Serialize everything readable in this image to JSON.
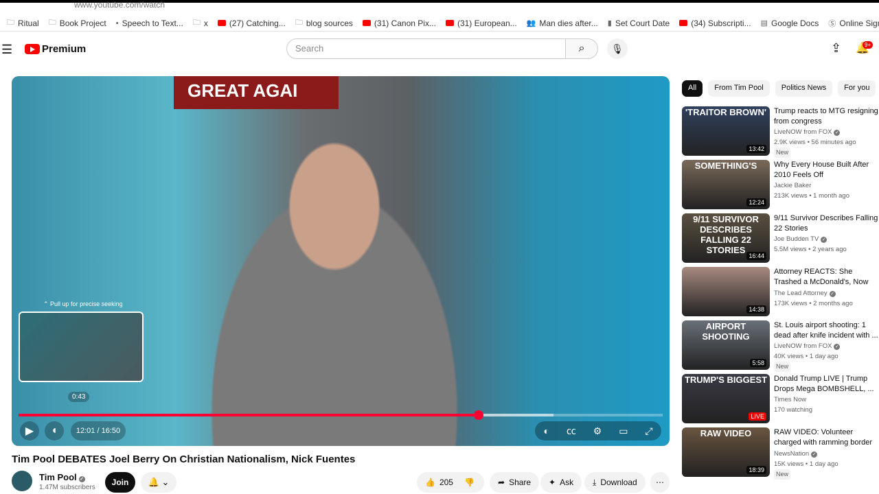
{
  "browser": {
    "url": "www.youtube.com/watch",
    "bookmarks": [
      {
        "icon": "folder-icon",
        "label": "Ritual"
      },
      {
        "icon": "folder-icon",
        "label": "Book Project"
      },
      {
        "icon": "page-icon",
        "label": "Speech to Text..."
      },
      {
        "icon": "folder-icon",
        "label": "x"
      },
      {
        "icon": "youtube-icon",
        "label": "(27) Catching..."
      },
      {
        "icon": "folder-icon",
        "label": "blog sources"
      },
      {
        "icon": "youtube-icon",
        "label": "(31) Canon Pix..."
      },
      {
        "icon": "youtube-icon",
        "label": "(31) European..."
      },
      {
        "icon": "people-icon",
        "label": "Man dies after..."
      },
      {
        "icon": "doc-icon",
        "label": "Set Court Date"
      },
      {
        "icon": "youtube-icon",
        "label": "(34) Subscripti..."
      },
      {
        "icon": "google-docs-icon",
        "label": "Google Docs"
      },
      {
        "icon": "signature-icon",
        "label": "Online Signatu..."
      }
    ]
  },
  "header": {
    "logo": "Premium",
    "search_placeholder": "Search",
    "notification_count": "9+"
  },
  "player": {
    "banner_text": "GREAT AGAI",
    "seek_hint": "⌃ Pull up for precise seeking",
    "preview_time": "0:43",
    "time": "12:01 / 16:50",
    "progress": 0.714,
    "buffered": 0.83,
    "hover_fraction": 0.045,
    "accent": "#ff0033"
  },
  "video": {
    "title": "Tim Pool DEBATES Joel Berry On Christian Nationalism, Nick Fuentes",
    "channel": "Tim Pool",
    "subscribers": "1.47M subscribers",
    "join": "Join",
    "likes": "205",
    "share": "Share",
    "ask": "Ask",
    "download": "Download"
  },
  "chips": [
    "All",
    "From Tim Pool",
    "Politics News",
    "For you"
  ],
  "recommendations": [
    {
      "thumb_text": "'TRAITOR BROWN'",
      "thumb_color": "#30415e",
      "duration": "13:42",
      "title": "Trump reacts to MTG resigning from congress",
      "channel": "LiveNOW from FOX",
      "verified": true,
      "meta": "2.9K views • 56 minutes ago",
      "badge": "New"
    },
    {
      "thumb_text": "SOMETHING'S",
      "thumb_color": "#7a6a5a",
      "duration": "12:24",
      "title": "Why Every House Built After 2010 Feels Off",
      "channel": "Jackie Baker",
      "verified": false,
      "meta": "213K views • 1 month ago",
      "badge": ""
    },
    {
      "thumb_text": "9/11 SURVIVOR DESCRIBES FALLING 22 STORIES",
      "thumb_color": "#5a5040",
      "duration": "16:44",
      "title": "9/11 Survivor Describes Falling 22 Stories",
      "channel": "Joe Budden TV",
      "verified": true,
      "meta": "5.5M views • 2 years ago",
      "badge": ""
    },
    {
      "thumb_text": "",
      "thumb_color": "#a88a80",
      "duration": "14:38",
      "title": "Attorney REACTS: She Trashed a McDonald's, Now She Faces ...",
      "channel": "The Lead Attorney",
      "verified": true,
      "meta": "173K views • 2 months ago",
      "badge": ""
    },
    {
      "thumb_text": "AIRPORT SHOOTING",
      "thumb_color": "#6a7078",
      "duration": "5:58",
      "title": "St. Louis airport shooting: 1 dead after knife incident with ...",
      "channel": "LiveNOW from FOX",
      "verified": true,
      "meta": "40K views • 1 day ago",
      "badge": "New"
    },
    {
      "thumb_text": "TRUMP'S BIGGEST",
      "thumb_color": "#3a3a44",
      "duration": "LIVE",
      "title": "Donald Trump LIVE | Trump Drops Mega BOMBSHELL, ...",
      "channel": "Times Now",
      "verified": false,
      "meta": "170 watching",
      "badge": ""
    },
    {
      "thumb_text": "RAW VIDEO",
      "thumb_color": "#6a5540",
      "duration": "18:39",
      "title": "RAW VIDEO: Volunteer charged with ramming border patrol in ...",
      "channel": "NewsNation",
      "verified": true,
      "meta": "15K views • 1 day ago",
      "badge": "New"
    }
  ]
}
